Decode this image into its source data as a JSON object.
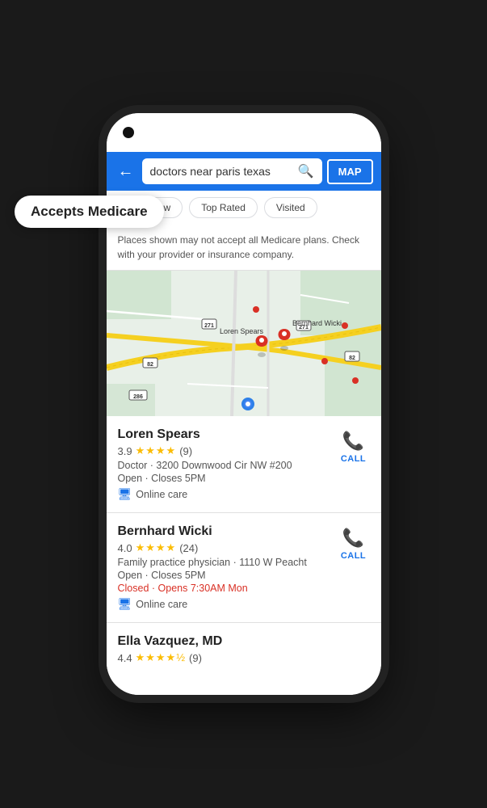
{
  "scene": {
    "background": "#1a1a1a"
  },
  "medicare_pill": {
    "label": "Accepts Medicare"
  },
  "search_bar": {
    "back_label": "←",
    "query": "doctors near paris texas",
    "map_label": "MAP"
  },
  "filters": [
    {
      "label": "Open now",
      "id": "open-now"
    },
    {
      "label": "Top Rated",
      "id": "top-rated"
    },
    {
      "label": "Visited",
      "id": "visited"
    }
  ],
  "medicare_notice": {
    "text": "Places shown may not accept all Medicare plans. Check with your provider or insurance company."
  },
  "results": [
    {
      "name": "Loren Spears",
      "rating": "3.9",
      "stars": "★★★★",
      "half_star": false,
      "reviews": "(9)",
      "detail1": "Doctor · 3200 Downwood Cir NW #200",
      "detail2": "Open · Closes 5PM",
      "closed_text": "",
      "online_care": "Online care",
      "call_label": "CALL"
    },
    {
      "name": "Bernhard Wicki",
      "rating": "4.0",
      "stars": "★★★★",
      "half_star": false,
      "reviews": "(24)",
      "detail1": "Family practice physician · 1110 W Peacht",
      "detail2": "Open · Closes 5PM",
      "closed_text": "Closed · Opens 7:30AM Mon",
      "online_care": "Online care",
      "call_label": "CALL"
    },
    {
      "name": "Ella Vazquez, MD",
      "rating": "4.4",
      "stars": "★★★★",
      "half_star": true,
      "reviews": "(9)",
      "detail1": "",
      "detail2": "",
      "closed_text": "",
      "online_care": "",
      "call_label": ""
    }
  ]
}
